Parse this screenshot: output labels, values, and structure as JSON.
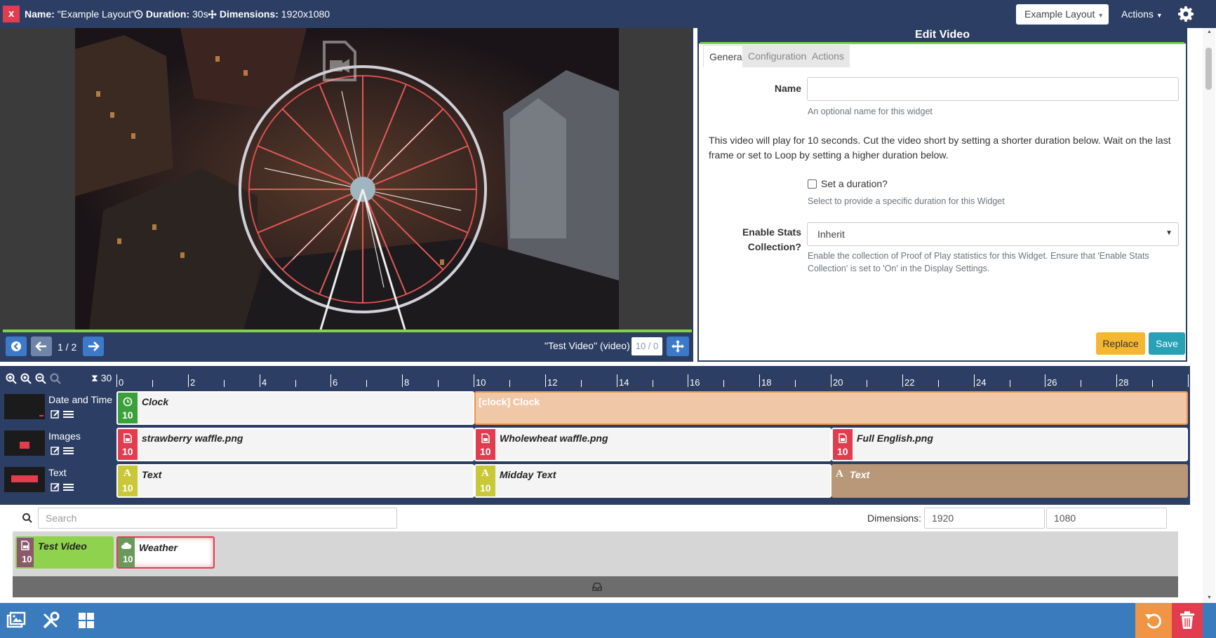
{
  "topbar": {
    "close_icon": "x",
    "name_label": "Name:",
    "name_value": "\"Example Layout\"",
    "duration_label": "Duration:",
    "duration_value": "30s",
    "dimensions_label": "Dimensions:",
    "dimensions_value": "1920x1080",
    "layout_select": "Example Layout",
    "actions_menu": "Actions",
    "settings_icon": "gear-icon"
  },
  "viewer": {
    "page_counter": "1 / 2",
    "widget_name": "\"Test Video\" (video)",
    "widget_duration": "10 / 0"
  },
  "edit_panel": {
    "title": "Edit Video",
    "tabs": [
      {
        "label": "General",
        "active": true
      },
      {
        "label": "Configuration",
        "active": false
      },
      {
        "label": "Actions",
        "active": false
      }
    ],
    "name_label": "Name",
    "name_value": "",
    "name_help": "An optional name for this widget",
    "description": "This video will play for 10 seconds. Cut the video short by setting a shorter duration below. Wait on the last frame or set to Loop by setting a higher duration below.",
    "set_duration_label": "Set a duration?",
    "set_duration_checked": false,
    "set_duration_help": "Select to provide a specific duration for this Widget",
    "stats_label_line1": "Enable Stats",
    "stats_label_line2": "Collection?",
    "stats_value": "Inherit",
    "stats_help": "Enable the collection of Proof of Play statistics for this Widget. Ensure that 'Enable Stats Collection' is set to 'On' in the Display Settings.",
    "replace_button": "Replace",
    "save_button": "Save"
  },
  "timeline": {
    "duration": "30",
    "ruler_labels": [
      "0",
      "2",
      "4",
      "6",
      "8",
      "10",
      "12",
      "14",
      "16",
      "18",
      "20",
      "22",
      "24",
      "26",
      "28"
    ],
    "regions": [
      {
        "name": "Date and Time",
        "widgets": [
          {
            "name": "Clock",
            "duration": "10",
            "icon": "clock-icon",
            "color": "#3aa13a"
          },
          {
            "name": "[clock] Clock",
            "duration": "",
            "icon": "",
            "color": "#f0c8a8"
          }
        ]
      },
      {
        "name": "Images",
        "widgets": [
          {
            "name": "strawberry waffle.png",
            "duration": "10",
            "icon": "image-file-icon",
            "color": "#e23d4f"
          },
          {
            "name": "Wholewheat waffle.png",
            "duration": "10",
            "icon": "image-file-icon",
            "color": "#e23d4f"
          },
          {
            "name": "Full English.png",
            "duration": "10",
            "icon": "image-file-icon",
            "color": "#e23d4f"
          }
        ]
      },
      {
        "name": "Text",
        "widgets": [
          {
            "name": "Text",
            "duration": "10",
            "icon": "text-icon",
            "color": "#c8c83a"
          },
          {
            "name": "Midday Text",
            "duration": "10",
            "icon": "text-icon",
            "color": "#c8c83a"
          },
          {
            "name": "Text",
            "duration": "",
            "icon": "text-icon",
            "color": "#b89878"
          }
        ]
      }
    ]
  },
  "library": {
    "search_placeholder": "Search",
    "dimensions_label": "Dimensions:",
    "width_value": "1920",
    "height_value": "1080",
    "widgets": [
      {
        "name": "Test Video",
        "duration": "10",
        "icon": "video-file-icon"
      },
      {
        "name": "Weather",
        "duration": "10",
        "icon": "cloud-icon"
      }
    ]
  },
  "bottombar": {
    "icons": [
      "media-library-icon",
      "tools-icon",
      "layout-grid-icon",
      "revert-icon",
      "trash-icon"
    ]
  }
}
